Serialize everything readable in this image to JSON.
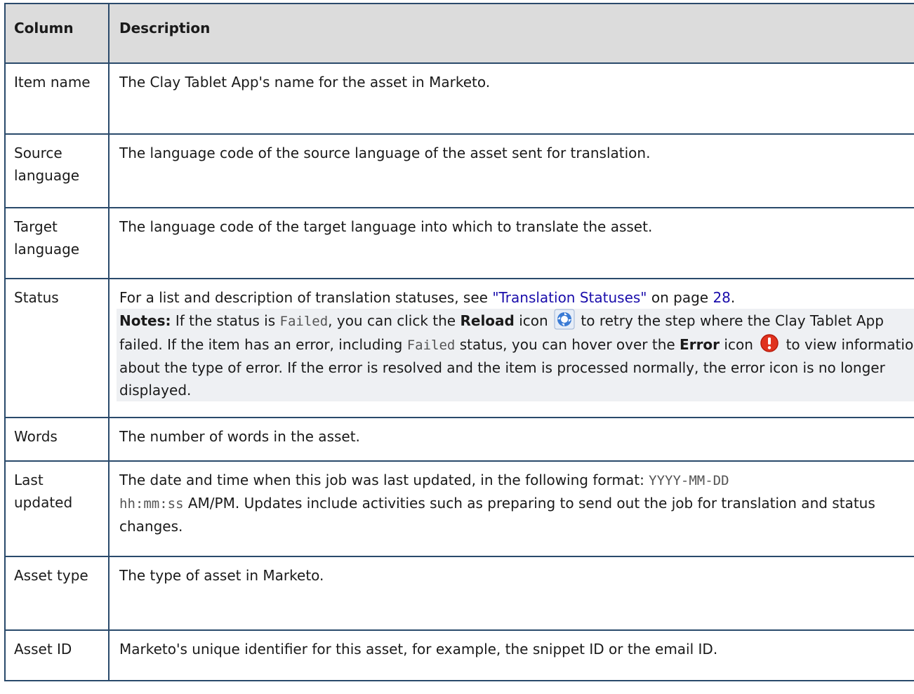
{
  "table": {
    "headers": [
      "Column",
      "Description"
    ],
    "rows": [
      {
        "column": "Item name",
        "description": "The Clay Tablet App's name for the asset in Marketo."
      },
      {
        "column": "Source language",
        "description": "The language code of the source language of the asset sent for translation."
      },
      {
        "column": "Target language",
        "description": "The language code of the target language into which to translate the asset."
      },
      {
        "column": "Status",
        "desc_prefix": "For a list and description of translation statuses, see ",
        "link_text": "\"Translation Statuses\"",
        "desc_mid": " on page ",
        "page_link": "28",
        "desc_end": ".",
        "notes_label": "Notes:",
        "notes_1": " If the status is ",
        "failed_code": "Failed",
        "notes_2": ", you can click the ",
        "reload_label": "Reload",
        "notes_3": " icon ",
        "notes_4": " to retry the step where the Clay Tablet App failed. If the item has an error, including ",
        "failed_code_2": "Failed",
        "notes_5": " status, you can hover over the ",
        "error_label": "Error",
        "notes_6": " icon ",
        "notes_7": " to view information about the type of error. If the error is resolved and the item is processed normally, the error icon is no longer displayed.",
        "icons": {
          "reload": "reload-icon",
          "error": "error-icon"
        }
      },
      {
        "column": "Words",
        "description": "The number of words in the asset."
      },
      {
        "column": "Last updated",
        "desc_prefix": "The date and time when this job was last updated, in the following format: ",
        "format_code_1": "YYYY-MM-DD",
        "format_code_2": "hh:mm:ss",
        "desc_rest": " AM/PM. Updates include activities such as preparing to send out the job for translation and status changes."
      },
      {
        "column": "Asset type",
        "description": "The type of asset in Marketo."
      },
      {
        "column": "Asset ID",
        "description": "Marketo's unique identifier for this asset, for example, the snippet ID or the email ID."
      }
    ]
  },
  "colors": {
    "border": "#2a4a6b",
    "header_bg": "#dcdcdc",
    "link": "#1a0dab",
    "notes_bg": "#eef0f3",
    "reload_icon": "#3a7bd5",
    "error_icon": "#e0321e"
  }
}
